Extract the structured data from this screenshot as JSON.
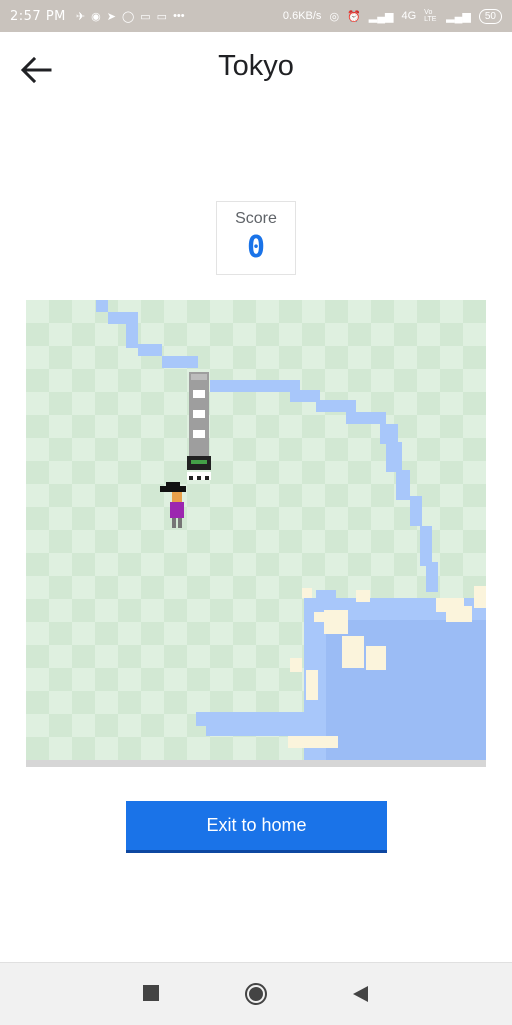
{
  "status_bar": {
    "time": "2:57 PM",
    "network_speed": "0.6KB/s",
    "network_type": "4G",
    "volte": "Vo LTE",
    "battery": "50"
  },
  "header": {
    "title": "Tokyo",
    "back_icon": "arrow-left-icon"
  },
  "score": {
    "label": "Score",
    "value": "0"
  },
  "game": {
    "colors": {
      "grass_light": "#dff0e0",
      "grass_dark": "#d2e8d3",
      "water": "#a8c7fa",
      "water_dark": "#9bbcf5",
      "sand": "#fbf4dc",
      "train": "#9e9e9e",
      "player_shirt": "#9c27b0"
    }
  },
  "actions": {
    "exit_label": "Exit to home"
  },
  "nav_bar": {
    "recent_icon": "square-icon",
    "home_icon": "circle-icon",
    "back_icon": "triangle-back-icon"
  }
}
